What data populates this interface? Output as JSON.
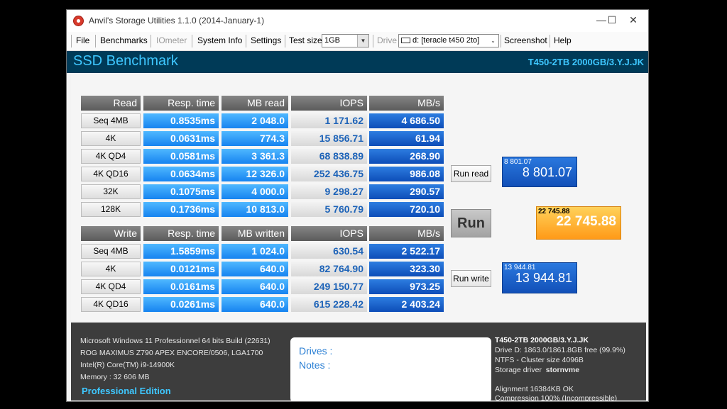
{
  "window": {
    "title": "Anvil's Storage Utilities 1.1.0 (2014-January-1)",
    "controls": {
      "minimize": "—",
      "maximize": "☐",
      "close": "✕"
    }
  },
  "menu": {
    "file": "File",
    "benchmarks": "Benchmarks",
    "iometer": "IOmeter",
    "system_info": "System Info",
    "settings": "Settings",
    "test_size_label": "Test size",
    "test_size_value": "1GB",
    "drive_label": "Drive",
    "drive_value": "d: [teracle t450 2to]",
    "screenshot": "Screenshot",
    "help": "Help"
  },
  "header": {
    "title": "SSD Benchmark",
    "drive_id": "T450-2TB 2000GB/3.Y.J.JK"
  },
  "read_table": {
    "headers": [
      "Read",
      "Resp. time",
      "MB read",
      "IOPS",
      "MB/s"
    ],
    "rows": [
      [
        "Seq 4MB",
        "0.8535ms",
        "2 048.0",
        "1 171.62",
        "4 686.50"
      ],
      [
        "4K",
        "0.0631ms",
        "774.3",
        "15 856.71",
        "61.94"
      ],
      [
        "4K QD4",
        "0.0581ms",
        "3 361.3",
        "68 838.89",
        "268.90"
      ],
      [
        "4K QD16",
        "0.0634ms",
        "12 326.0",
        "252 436.75",
        "986.08"
      ],
      [
        "32K",
        "0.1075ms",
        "4 000.0",
        "9 298.27",
        "290.57"
      ],
      [
        "128K",
        "0.1736ms",
        "10 813.0",
        "5 760.79",
        "720.10"
      ]
    ]
  },
  "write_table": {
    "headers": [
      "Write",
      "Resp. time",
      "MB written",
      "IOPS",
      "MB/s"
    ],
    "rows": [
      [
        "Seq 4MB",
        "1.5859ms",
        "1 024.0",
        "630.54",
        "2 522.17"
      ],
      [
        "4K",
        "0.0121ms",
        "640.0",
        "82 764.90",
        "323.30"
      ],
      [
        "4K QD4",
        "0.0161ms",
        "640.0",
        "249 150.77",
        "973.25"
      ],
      [
        "4K QD16",
        "0.0261ms",
        "640.0",
        "615 228.42",
        "2 403.24"
      ]
    ]
  },
  "buttons": {
    "run_read": "Run read",
    "run": "Run",
    "run_write": "Run write"
  },
  "scores": {
    "read_small": "8 801.07",
    "read_big": "8 801.07",
    "total_small": "22 745.88",
    "total_big": "22 745.88",
    "write_small": "13 944.81",
    "write_big": "13 944.81"
  },
  "system_info": {
    "os": "Microsoft Windows 11 Professionnel 64 bits Build (22631)",
    "board": "ROG MAXIMUS Z790 APEX ENCORE/0506, LGA1700",
    "cpu": "Intel(R) Core(TM) i9-14900K",
    "memory": "Memory : 32 606 MB",
    "edition": "Professional Edition"
  },
  "notes": {
    "drives_label": "Drives :",
    "notes_label": "Notes :"
  },
  "drive_info": {
    "model": "T450-2TB 2000GB/3.Y.J.JK",
    "space": "Drive D: 1863.0/1861.8GB free (99.9%)",
    "fs": "NTFS - Cluster size 4096B",
    "driver_label": "Storage driver",
    "driver_value": "stornvme",
    "alignment": "Alignment 16384KB OK",
    "compression": "Compression 100% (Incompressible)"
  }
}
